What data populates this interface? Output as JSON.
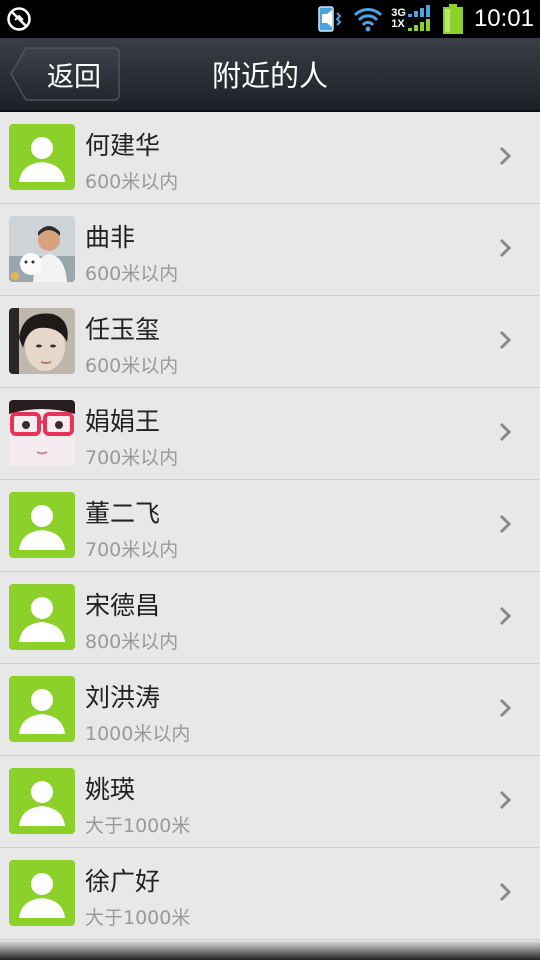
{
  "status_bar": {
    "time": "10:01",
    "network_top": "3G",
    "network_bottom": "1X",
    "icons": [
      "no-sync-icon",
      "vibrate-icon",
      "wifi-icon",
      "signal-icon",
      "battery-icon"
    ]
  },
  "header": {
    "back_label": "返回",
    "title": "附近的人"
  },
  "colors": {
    "accent_green": "#8bd12a",
    "title_bar": "#2a2e35",
    "list_bg": "#e8e8e8"
  },
  "people": [
    {
      "name": "何建华",
      "distance": "600米以内",
      "avatar": "default-avatar-icon"
    },
    {
      "name": "曲非",
      "distance": "600米以内",
      "avatar": "photo-man-with-dog"
    },
    {
      "name": "任玉玺",
      "distance": "600米以内",
      "avatar": "photo-young-man"
    },
    {
      "name": "娟娟王",
      "distance": "700米以内",
      "avatar": "photo-girl-glasses"
    },
    {
      "name": "董二飞",
      "distance": "700米以内",
      "avatar": "default-avatar-icon"
    },
    {
      "name": "宋德昌",
      "distance": "800米以内",
      "avatar": "default-avatar-icon"
    },
    {
      "name": "刘洪涛",
      "distance": "1000米以内",
      "avatar": "default-avatar-icon"
    },
    {
      "name": "姚瑛",
      "distance": "大于1000米",
      "avatar": "default-avatar-icon"
    },
    {
      "name": "徐广好",
      "distance": "大于1000米",
      "avatar": "default-avatar-icon"
    }
  ]
}
